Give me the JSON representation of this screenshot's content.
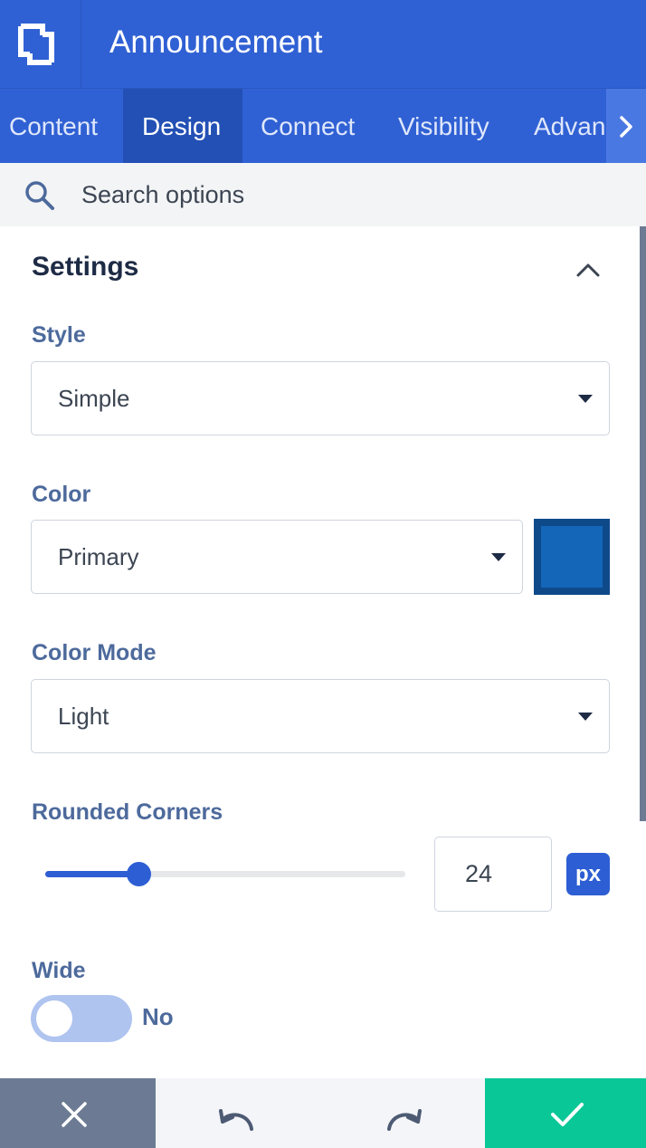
{
  "header": {
    "title": "Announcement",
    "logo_icon": "builder-logo-icon"
  },
  "tabs": {
    "items": [
      {
        "label": "Content"
      },
      {
        "label": "Design"
      },
      {
        "label": "Connect"
      },
      {
        "label": "Visibility"
      },
      {
        "label": "Advan"
      }
    ],
    "active": "Design",
    "next_icon": "chevron-right-icon"
  },
  "search": {
    "placeholder": "Search options",
    "icon": "search-icon"
  },
  "settings": {
    "title": "Settings",
    "style": {
      "label": "Style",
      "value": "Simple"
    },
    "color": {
      "label": "Color",
      "value": "Primary",
      "swatch": "#1466b9"
    },
    "color_mode": {
      "label": "Color Mode",
      "value": "Light"
    },
    "rounded_corners": {
      "label": "Rounded Corners",
      "value": "24",
      "unit": "px",
      "slider_fraction": 0.26
    },
    "wide": {
      "label": "Wide",
      "state": "No"
    }
  },
  "footer": {
    "cancel_icon": "close-icon",
    "undo_icon": "undo-icon",
    "redo_icon": "redo-icon",
    "save_icon": "check-icon",
    "colors": {
      "cancel": "#6c7b93",
      "toolbar": "#f3f5f9",
      "save": "#09c796"
    }
  },
  "colors": {
    "primary": "#3061d4",
    "accent": "#2d5ed3",
    "label": "#4d6a9c"
  }
}
